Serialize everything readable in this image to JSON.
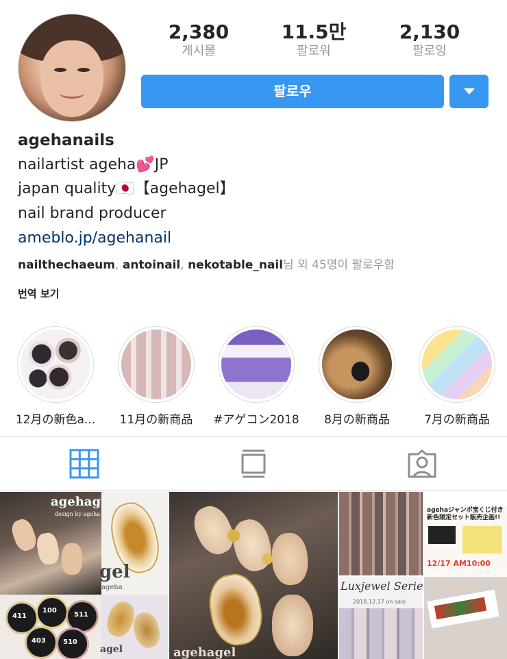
{
  "profile": {
    "username": "agehanails",
    "bio_line1": "nailartist ageha💕JP",
    "bio_line2": "japan quality🇯🇵【agehagel】",
    "bio_line3": "nail brand producer",
    "website": "ameblo.jp/agehanail",
    "followed_by": {
      "names": [
        "nailthechaeum",
        "antoinail",
        "nekotable_nail"
      ],
      "suffix": "님 외 45명이 팔로우함"
    },
    "translate_label": "번역 보기"
  },
  "stats": [
    {
      "value": "2,380",
      "label": "게시물"
    },
    {
      "value": "11.5만",
      "label": "팔로워"
    },
    {
      "value": "2,130",
      "label": "팔로잉"
    }
  ],
  "actions": {
    "follow_label": "팔로우"
  },
  "highlights": [
    {
      "caption": "12月の新色a..."
    },
    {
      "caption": "11月の新商品"
    },
    {
      "caption": "#アゲコン2018"
    },
    {
      "caption": "8月の新商品"
    },
    {
      "caption": "7月の新商品"
    }
  ],
  "tabs": [
    {
      "name": "grid-icon",
      "active": true
    },
    {
      "name": "feed-icon",
      "active": false
    },
    {
      "name": "tagged-icon",
      "active": false
    }
  ],
  "grid": {
    "tile1_text": "agehagel",
    "tile1_sub": "design by ageha",
    "tile3_text": "agehagel",
    "tile3_sub": "ageha",
    "tile4_banner": "agehaジャンボ宝くじ付き新色限定セット販売企画!!",
    "tile4_date": "12/17 AM10:00",
    "tile4_title": "Luxjewel Series",
    "tile4_sale": "2018.12.17 on sale",
    "pot_labels": [
      "411",
      "100",
      "511",
      "403",
      "510"
    ]
  },
  "colors": {
    "accent": "#3897f0",
    "link": "#003569",
    "muted": "#999999",
    "active_tab": "#3897f0"
  }
}
